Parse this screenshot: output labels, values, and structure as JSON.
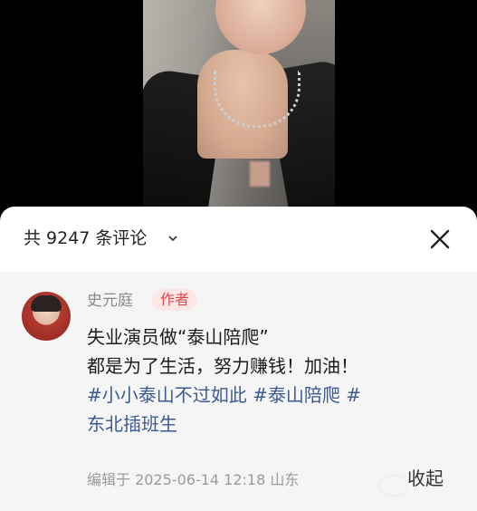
{
  "comments_sheet": {
    "count_title": "共 9247 条评论",
    "icons": {
      "expand": "chevron-down-icon",
      "close": "close-icon"
    }
  },
  "comment": {
    "author_name": "史元庭",
    "author_tag": "作者",
    "text_line1": "失业演员做“泰山陪爬”",
    "text_line2": "都是为了生活，努力赚钱！加油！",
    "hashtag1": "#小小泰山不过如此",
    "hashtag2": "#泰山陪爬",
    "hashtag3_part1": "#",
    "hashtag3_part2": "东北插班生",
    "meta": "编辑于 2025-06-14 12:18 山东",
    "collapse_label": "收起"
  },
  "colors": {
    "hashtag": "#3c5a92",
    "author_tag_text": "#e5474e",
    "author_tag_bg": "#fde6e6"
  }
}
